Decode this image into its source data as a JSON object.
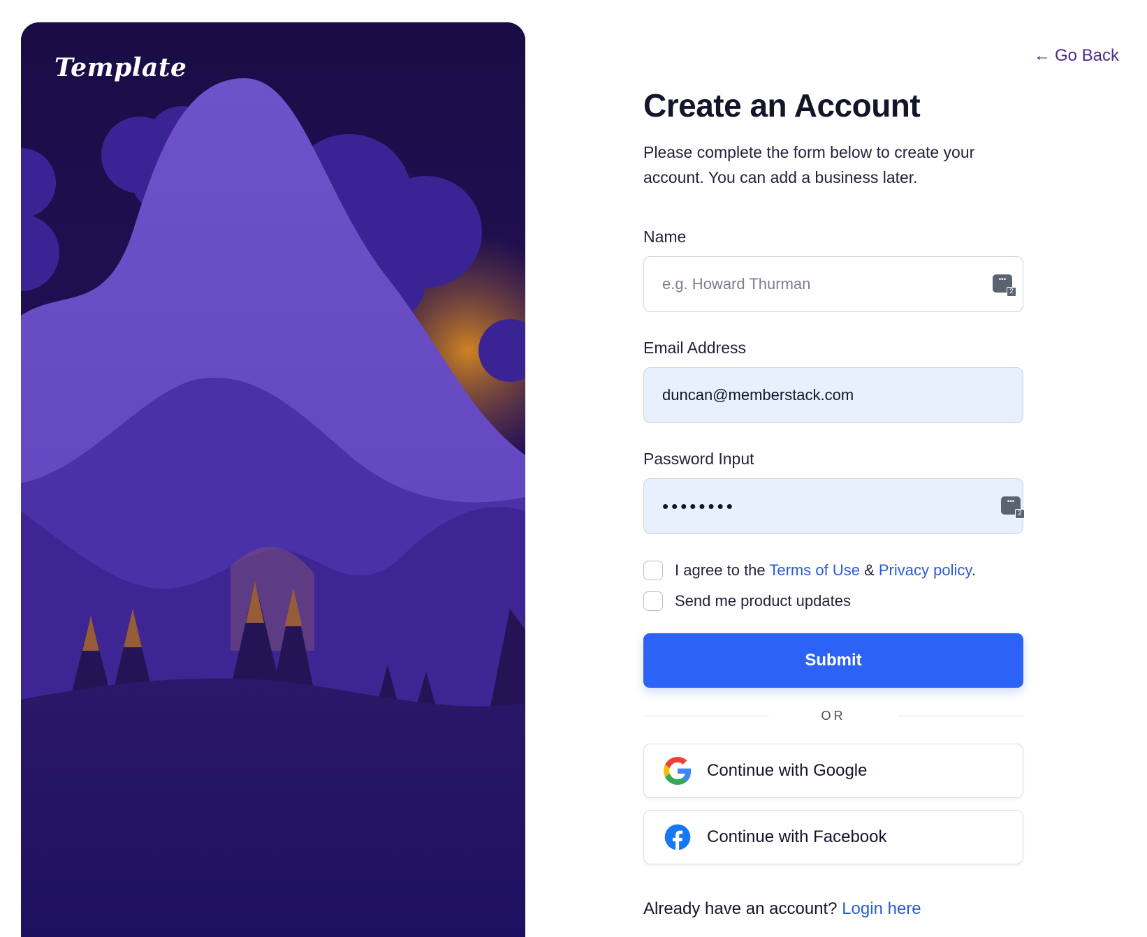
{
  "brand": {
    "logo_text": "Template"
  },
  "nav": {
    "go_back_arrow": "←",
    "go_back_label": "Go Back"
  },
  "form": {
    "title": "Create an Account",
    "subtitle": "Please complete the form below to create your account. You can add a business later.",
    "name": {
      "label": "Name",
      "placeholder": "e.g. Howard Thurman",
      "value": ""
    },
    "email": {
      "label": "Email Address",
      "value": "duncan@memberstack.com"
    },
    "password": {
      "label": "Password Input",
      "value": "••••••••"
    },
    "password_manager_badge": "2",
    "terms": {
      "prefix": "I agree to the ",
      "terms_link": "Terms of Use",
      "joiner": " & ",
      "privacy_link": "Privacy policy",
      "suffix": "."
    },
    "updates_label": "Send me product updates",
    "submit_label": "Submit",
    "divider_label": "OR",
    "google_label": "Continue with Google",
    "facebook_label": "Continue with Facebook",
    "login_prompt": "Already have an account? ",
    "login_link": "Login here"
  },
  "colors": {
    "primary": "#2c62f5",
    "link": "#2a5bd7",
    "go_back": "#4b2a8c",
    "autofill_bg": "#e8f0fe",
    "hero_bg": "#1c0f47"
  },
  "icons": [
    "google-icon",
    "facebook-icon",
    "password-manager-icon",
    "arrow-left-icon"
  ]
}
